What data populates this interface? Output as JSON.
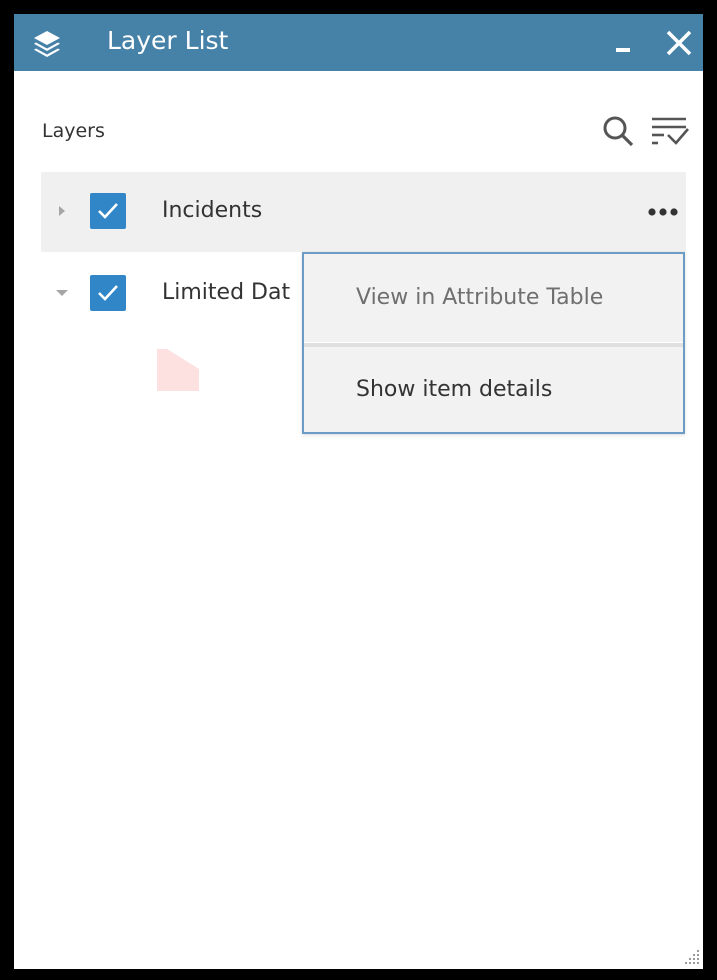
{
  "window": {
    "title": "Layer List",
    "accent_color": "#4682a8",
    "icons": {
      "app": "layers-icon",
      "minimize": "minimize-icon",
      "close": "close-icon"
    }
  },
  "toolbar": {
    "section_label": "Layers",
    "icons": {
      "search": "search-icon",
      "filter": "filter-list-icon"
    }
  },
  "layers": [
    {
      "name": "Incidents",
      "checked": true,
      "expanded": false,
      "has_options": true
    },
    {
      "name": "Limited Dat",
      "checked": true,
      "expanded": true,
      "legend_color": "#fde0e0"
    }
  ],
  "context_menu": {
    "items": [
      {
        "label": "View in Attribute Table",
        "enabled": false
      },
      {
        "label": "Show item details",
        "enabled": true
      }
    ]
  },
  "colors": {
    "checkbox": "#3186c8",
    "row_highlight": "#f0f0f0",
    "menu_border": "#6a9cc6"
  }
}
